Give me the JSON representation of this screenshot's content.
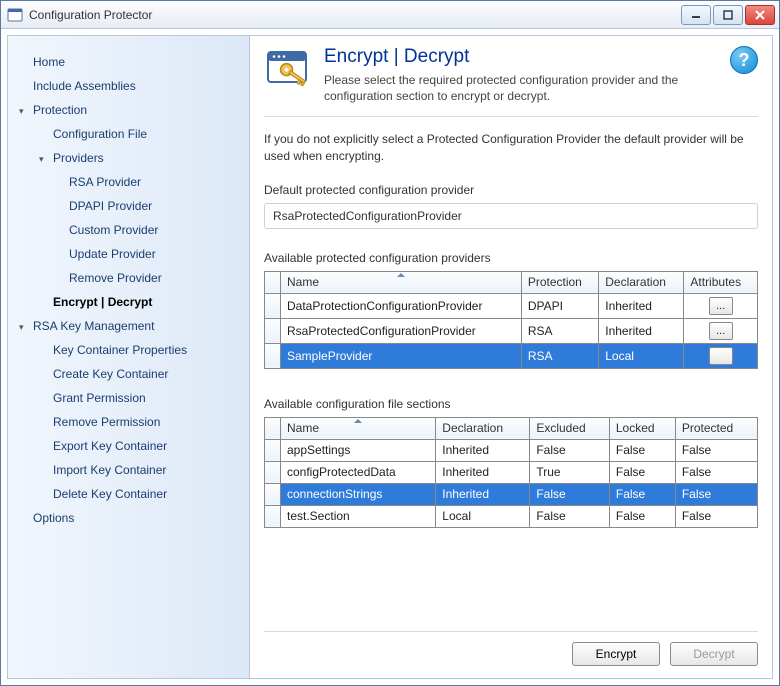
{
  "window": {
    "title": "Configuration Protector"
  },
  "nav": {
    "home": "Home",
    "include_assemblies": "Include Assemblies",
    "protection": "Protection",
    "configuration_file": "Configuration File",
    "providers": "Providers",
    "rsa_provider": "RSA Provider",
    "dpapi_provider": "DPAPI Provider",
    "custom_provider": "Custom Provider",
    "update_provider": "Update Provider",
    "remove_provider": "Remove Provider",
    "encrypt_decrypt": "Encrypt | Decrypt",
    "rsa_key_management": "RSA Key Management",
    "key_container_properties": "Key Container Properties",
    "create_key_container": "Create Key Container",
    "grant_permission": "Grant Permission",
    "remove_permission": "Remove Permission",
    "export_key_container": "Export Key Container",
    "import_key_container": "Import Key Container",
    "delete_key_container": "Delete Key Container",
    "options": "Options"
  },
  "header": {
    "title": "Encrypt | Decrypt",
    "subtitle": "Please select the required protected configuration provider and the configuration section to encrypt or decrypt."
  },
  "info": "If you do not explicitly select a Protected Configuration Provider the default provider will be used when encrypting.",
  "default_provider": {
    "label": "Default protected configuration provider",
    "value": "RsaProtectedConfigurationProvider"
  },
  "providers_table": {
    "caption": "Available protected configuration providers",
    "cols": {
      "name": "Name",
      "protection": "Protection",
      "declaration": "Declaration",
      "attributes": "Attributes"
    },
    "ellipsis": "...",
    "rows": [
      {
        "name": "DataProtectionConfigurationProvider",
        "protection": "DPAPI",
        "declaration": "Inherited",
        "selected": false
      },
      {
        "name": "RsaProtectedConfigurationProvider",
        "protection": "RSA",
        "declaration": "Inherited",
        "selected": false
      },
      {
        "name": "SampleProvider",
        "protection": "RSA",
        "declaration": "Local",
        "selected": true
      }
    ]
  },
  "sections_table": {
    "caption": "Available configuration file sections",
    "cols": {
      "name": "Name",
      "declaration": "Declaration",
      "excluded": "Excluded",
      "locked": "Locked",
      "protected": "Protected"
    },
    "rows": [
      {
        "name": "appSettings",
        "declaration": "Inherited",
        "excluded": "False",
        "locked": "False",
        "protected": "False",
        "selected": false
      },
      {
        "name": "configProtectedData",
        "declaration": "Inherited",
        "excluded": "True",
        "locked": "False",
        "protected": "False",
        "selected": false
      },
      {
        "name": "connectionStrings",
        "declaration": "Inherited",
        "excluded": "False",
        "locked": "False",
        "protected": "False",
        "selected": true
      },
      {
        "name": "test.Section",
        "declaration": "Local",
        "excluded": "False",
        "locked": "False",
        "protected": "False",
        "selected": false
      }
    ]
  },
  "buttons": {
    "encrypt": "Encrypt",
    "decrypt": "Decrypt"
  },
  "help_glyph": "?"
}
